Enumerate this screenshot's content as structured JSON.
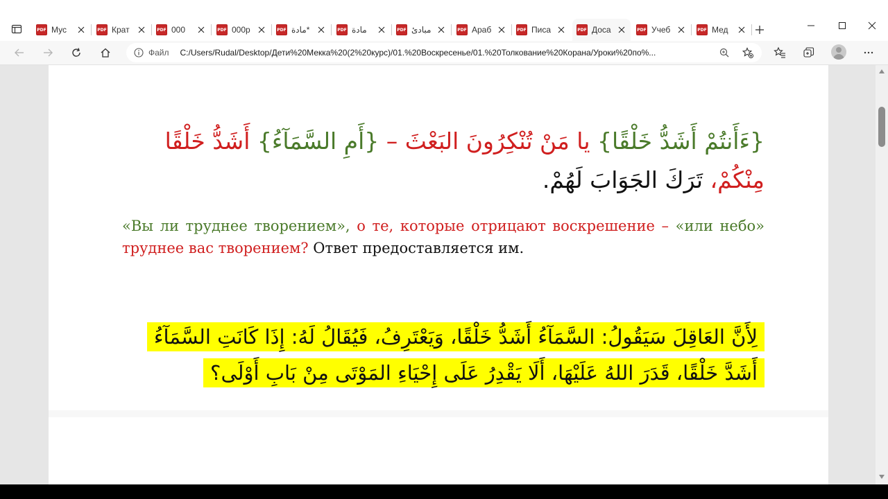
{
  "tabs": [
    {
      "label": "Мус",
      "active": false
    },
    {
      "label": "Крат",
      "active": false
    },
    {
      "label": "000",
      "active": false
    },
    {
      "label": "000р",
      "active": false
    },
    {
      "label": "مادة*",
      "active": false
    },
    {
      "label": "مادة",
      "active": false
    },
    {
      "label": "مبادئ",
      "active": false
    },
    {
      "label": "Араб",
      "active": false
    },
    {
      "label": "Писа",
      "active": false
    },
    {
      "label": "Доса",
      "active": true
    },
    {
      "label": "Учеб",
      "active": false
    },
    {
      "label": "Мед",
      "active": false
    }
  ],
  "tab_icon_label": "PDF",
  "address_bar": {
    "scheme_label": "Файл",
    "url": "C:/Users/Rudal/Desktop/Дети%20Мекка%20(2%20курс)/01.%20Воскресенье/01.%20Толкование%20Корана/Уроки%20по%..."
  },
  "document": {
    "arabic_block_1": {
      "part1": "{ءَأَنتُمْ أَشَدُّ خَلْقًا}",
      "part2": " يا مَنْ تُنْكِرُونَ البَعْثَ – ",
      "part3": "{أَمِ السَّمَآءُ}",
      "part4": " أَشَدُّ خَلْقًا مِنْكُمْ،",
      "part5": " تَرَكَ الجَوَابَ لَهُمْ."
    },
    "russian_block": {
      "part1": "«Вы ли труднее творением»,",
      "part2": " о те, которые отрицают воскрешение – ",
      "part3": "«или небо»",
      "part4": " труднее вас творением?",
      "part5": " Ответ предоставляется им."
    },
    "arabic_block_2": "لِأَنَّ العَاقِلَ سَيَقُولُ: السَّمَآءُ أَشَدُّ خَلْقًا، وَيَعْتَرِفُ، فَيُقَالُ لَهُ: إِذَا كَانَتِ السَّمَآءُ أَشَدَّ خَلْقًا، قَدَرَ اللهُ عَلَيْهَا، أَلَا يَقْدِرُ عَلَى إِحْيَاءِ المَوْتَى مِنْ بَابِ أَوْلَى؟"
  },
  "colors": {
    "quran_green": "#4a7a2a",
    "commentary_red": "#d01f1f",
    "highlight_yellow": "#ffff00"
  },
  "icons": [
    "tab-actions-icon",
    "pdf-icon",
    "close-icon",
    "plus-icon",
    "minimize-icon",
    "maximize-icon",
    "window-close-icon",
    "back-icon",
    "forward-icon",
    "refresh-icon",
    "home-icon",
    "info-icon",
    "zoom-icon",
    "favorite-add-icon",
    "favorites-icon",
    "collections-icon",
    "profile-avatar",
    "more-icon"
  ]
}
